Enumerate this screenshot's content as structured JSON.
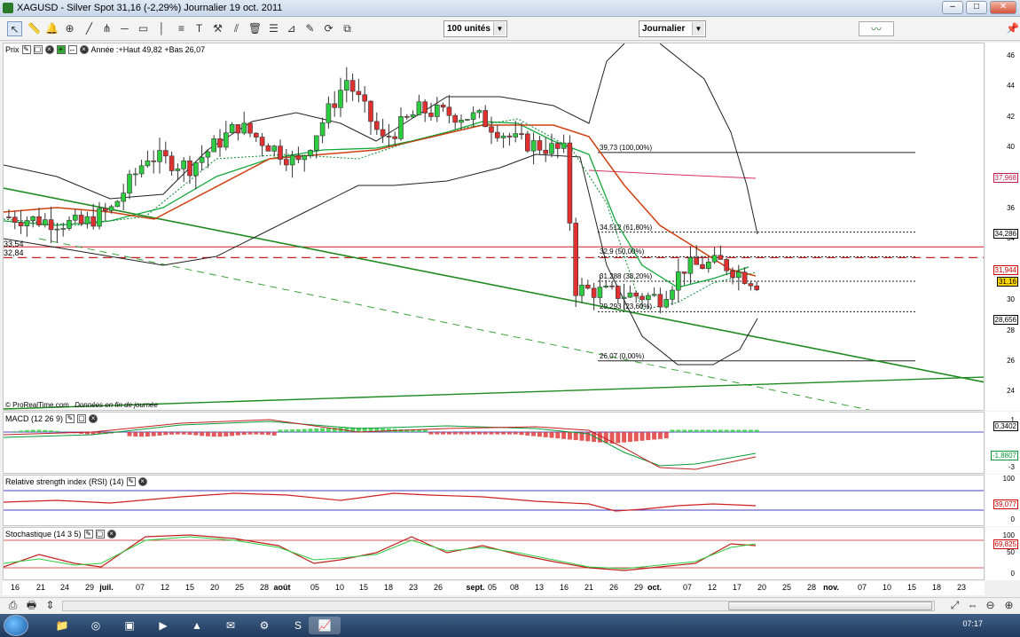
{
  "window": {
    "title": "XAGUSD - Silver Spot   31,16 (-2,29%)   Journalier  19 oct. 2011"
  },
  "toolbar": {
    "units_select": "100 unités",
    "period_select": "Journalier"
  },
  "price_panel": {
    "label": "Prix",
    "year_info": "Année :+Haut 49,82 +Bas 26,07",
    "credit": "© ProRealTime.com",
    "credit_note": "Données en fin de journée",
    "left_levels": [
      "33,54",
      "32,84"
    ],
    "fib_labels": [
      "39,73 (100,00%)",
      "34,512 (61,80%)",
      "32,9 (50,00%)",
      "31,288 (38,20%)",
      "29,293 (23,60%)",
      "26,07 (0,00%)"
    ],
    "axis_ticks": [
      "46",
      "44",
      "42",
      "40",
      "38",
      "36",
      "34",
      "32",
      "30",
      "28",
      "26",
      "24"
    ],
    "axis_tags": [
      {
        "text": "37,968",
        "color": "#c02050"
      },
      {
        "text": "34,286",
        "color": "#000000"
      },
      {
        "text": "31,944",
        "color": "#d00000"
      },
      {
        "text": "31,16",
        "color": "#000000",
        "bg": "#ffd700"
      },
      {
        "text": "28,656",
        "color": "#000000"
      }
    ]
  },
  "macd_panel": {
    "label": "MACD (12 26 9)",
    "axis_ticks": [
      "1",
      "-3"
    ],
    "axis_tags": [
      {
        "text": "0,3402",
        "color": "#000000"
      },
      {
        "text": "-1,8807",
        "color": "#0a9a3a"
      }
    ]
  },
  "rsi_panel": {
    "label": "Relative strength index (RSI) (14)",
    "axis_ticks": [
      "100",
      "0"
    ],
    "axis_tags": [
      {
        "text": "39,077",
        "color": "#d00000"
      }
    ]
  },
  "stoch_panel": {
    "label": "Stochastique (14 3 5)",
    "axis_ticks": [
      "100",
      "50",
      "0"
    ],
    "axis_tags": [
      {
        "text": "69,825",
        "color": "#d00000"
      }
    ]
  },
  "time_axis": [
    "16",
    "21",
    "24",
    "29",
    "juil.",
    "07",
    "12",
    "15",
    "20",
    "25",
    "28",
    "août",
    "05",
    "10",
    "15",
    "18",
    "23",
    "26",
    "sept.",
    "05",
    "08",
    "13",
    "16",
    "21",
    "26",
    "29",
    "oct.",
    "07",
    "12",
    "17",
    "20",
    "25",
    "28",
    "nov.",
    "07",
    "10",
    "15",
    "18",
    "23"
  ],
  "taskbar": {
    "clock": "07:17"
  },
  "colors": {
    "bull": "#2ecc40",
    "bear": "#e03030",
    "ma_red": "#d04010",
    "ma_green": "#12a83c",
    "trend": "#1f8a1f"
  }
}
